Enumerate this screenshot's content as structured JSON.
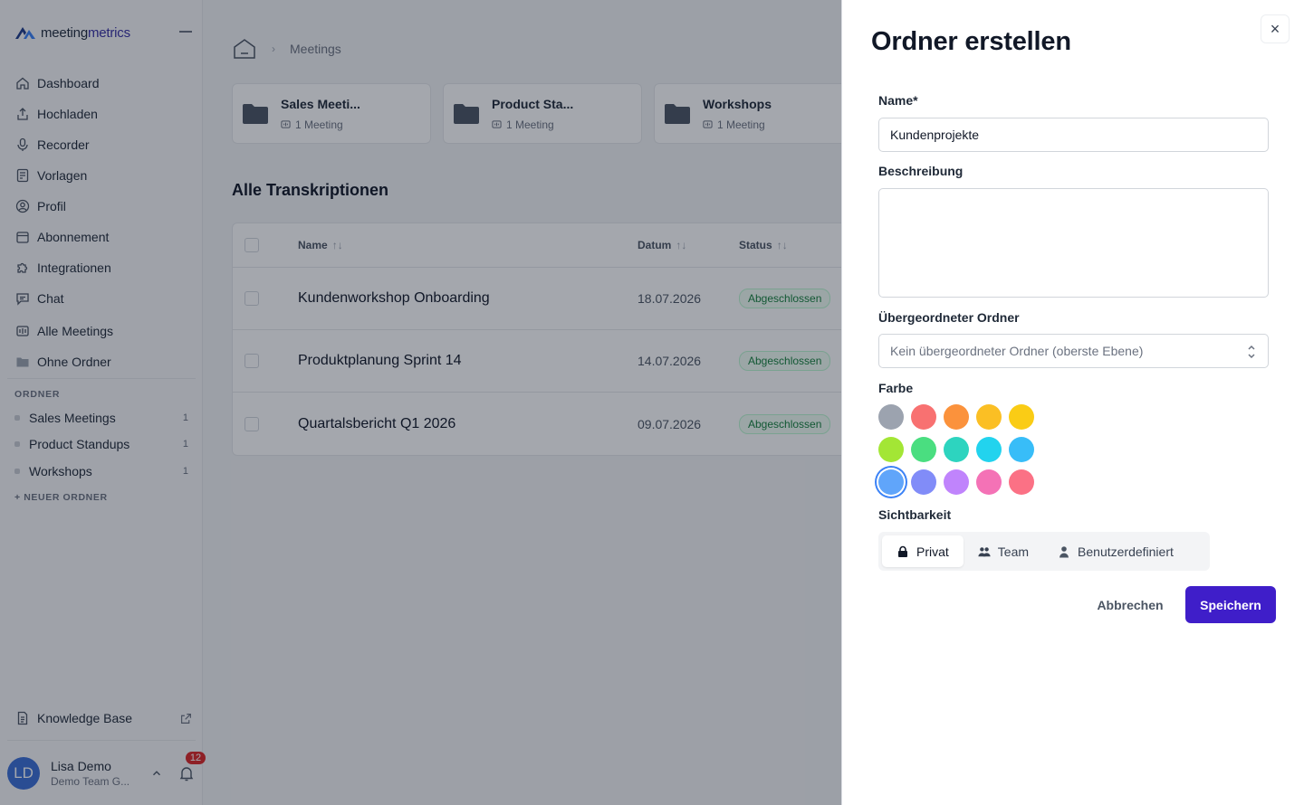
{
  "app": {
    "logo_prefix": "meeting",
    "logo_suffix": "metrics"
  },
  "sidebar": {
    "nav": [
      {
        "label": "Dashboard",
        "icon": "home-icon"
      },
      {
        "label": "Hochladen",
        "icon": "upload-icon"
      },
      {
        "label": "Recorder",
        "icon": "microphone-icon"
      },
      {
        "label": "Vorlagen",
        "icon": "template-icon"
      },
      {
        "label": "Profil",
        "icon": "profile-icon"
      },
      {
        "label": "Abonnement",
        "icon": "subscription-icon"
      },
      {
        "label": "Integrationen",
        "icon": "puzzle-icon"
      },
      {
        "label": "Chat",
        "icon": "chat-icon"
      },
      {
        "label": "Alle Meetings",
        "icon": "meetings-icon"
      },
      {
        "label": "Ohne Ordner",
        "icon": "folder-icon"
      }
    ],
    "folders_label": "ORDNER",
    "folders": [
      {
        "name": "Sales Meetings",
        "count": "1"
      },
      {
        "name": "Product Standups",
        "count": "1"
      },
      {
        "name": "Workshops",
        "count": "1"
      }
    ],
    "new_folder": "+ NEUER ORDNER",
    "knowledge_base": "Knowledge Base",
    "user": {
      "initials": "LD",
      "name": "Lisa Demo",
      "team": "Demo Team G...",
      "notifications": "12"
    }
  },
  "main": {
    "breadcrumb": "Meetings",
    "cards": [
      {
        "title": "Sales Meeti...",
        "meta": "1 Meeting"
      },
      {
        "title": "Product Sta...",
        "meta": "1 Meeting"
      },
      {
        "title": "Workshops",
        "meta": "1 Meeting"
      }
    ],
    "section_title": "Alle Transkriptionen",
    "columns": {
      "name": "Name",
      "date": "Datum",
      "status": "Status"
    },
    "rows": [
      {
        "name": "Kundenworkshop Onboarding",
        "date": "18.07.2026",
        "status": "Abgeschlossen"
      },
      {
        "name": "Produktplanung Sprint 14",
        "date": "14.07.2026",
        "status": "Abgeschlossen"
      },
      {
        "name": "Quartalsbericht Q1 2026",
        "date": "09.07.2026",
        "status": "Abgeschlossen"
      }
    ]
  },
  "panel": {
    "title": "Ordner erstellen",
    "name_label": "Name*",
    "name_value": "Kundenprojekte",
    "description_label": "Beschreibung",
    "description_value": "",
    "parent_label": "Übergeordneter Ordner",
    "parent_value": "Kein übergeordneter Ordner (oberste Ebene)",
    "color_label": "Farbe",
    "colors": [
      [
        "#9ca3af",
        "#f87171",
        "#fb923c",
        "#fbbf24",
        "#facc15"
      ],
      [
        "#a3e635",
        "#4ade80",
        "#2dd4bf",
        "#22d3ee",
        "#38bdf8"
      ],
      [
        "#60a5fa",
        "#818cf8",
        "#c084fc",
        "#f472b6",
        "#fb7185"
      ]
    ],
    "selected_color": "#60a5fa",
    "visibility_label": "Sichtbarkeit",
    "visibility_options": [
      "Privat",
      "Team",
      "Benutzerdefiniert"
    ],
    "visibility_selected": "Privat",
    "cancel": "Abbrechen",
    "save": "Speichern",
    "close": "×"
  },
  "colors": {
    "primary": "#3f1ec9",
    "status_green": "#15803d"
  }
}
